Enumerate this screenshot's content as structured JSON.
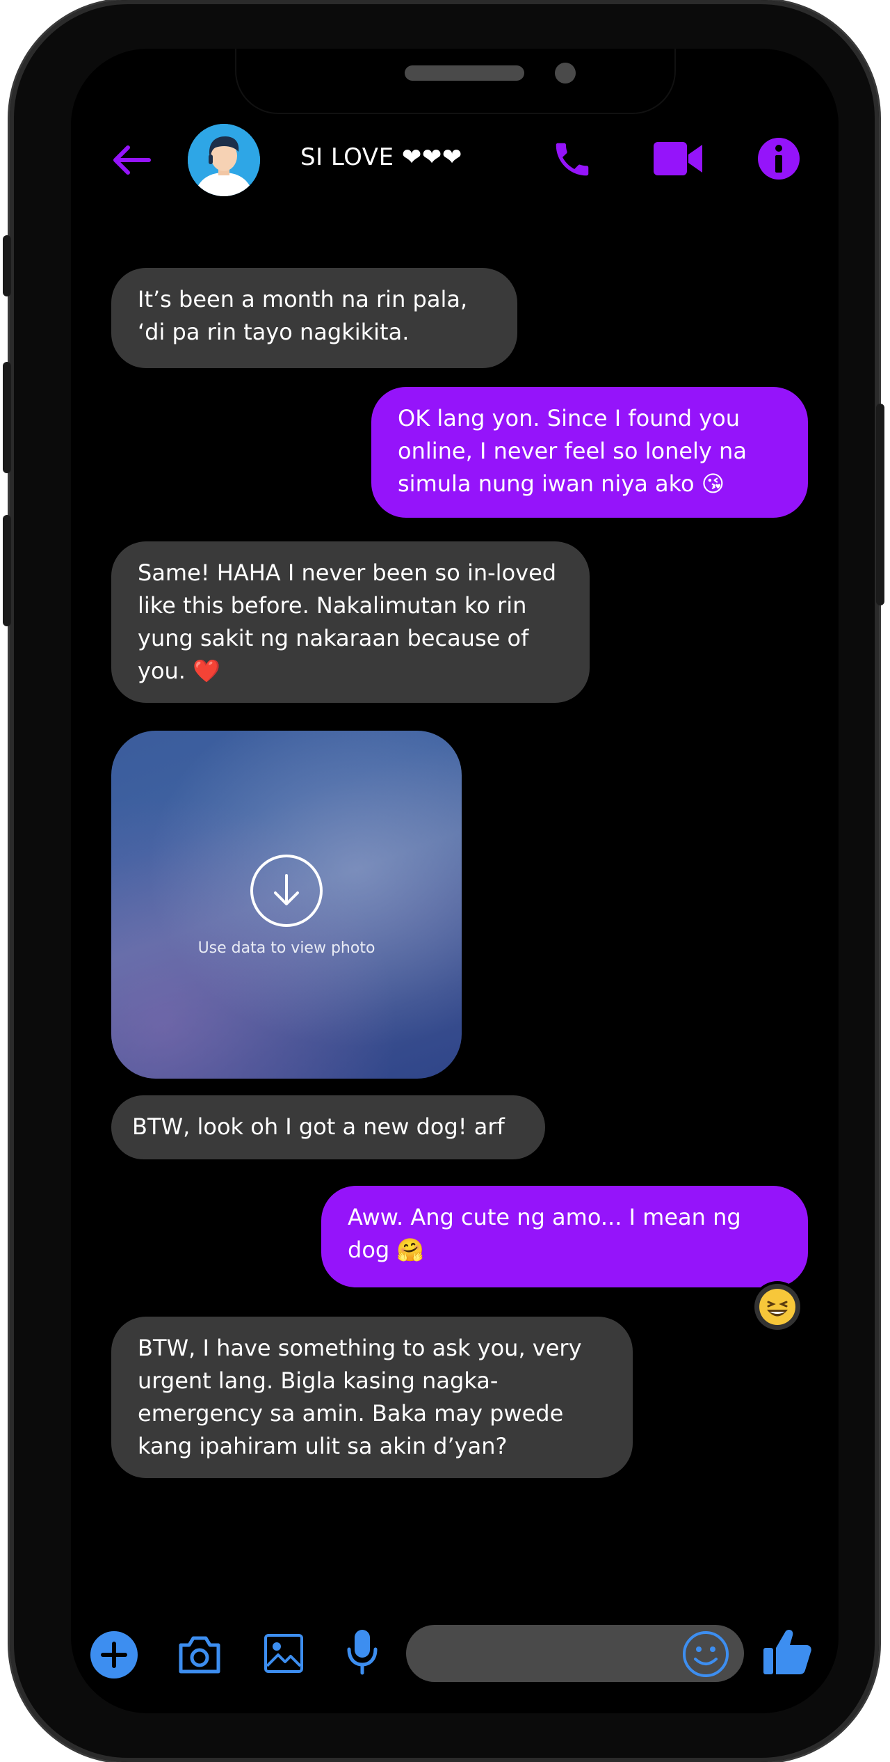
{
  "header": {
    "contact_name": "SI LOVE ❤❤❤"
  },
  "messages": [
    {
      "side": "in",
      "text": "It’s been a month na rin pala, ‘di pa rin tayo nagkikita."
    },
    {
      "side": "out",
      "text": "OK lang yon. Since I found you online, I never feel so lonely na simula nung iwan niya ako 😘"
    },
    {
      "side": "in",
      "text": "Same! HAHA I never been so in-loved like this before. Nakalimutan ko rin yung sakit ng nakaraan because of you. ❤️"
    },
    {
      "side": "in",
      "text": "BTW, look oh I got a new dog! arf"
    },
    {
      "side": "out",
      "text": "Aww. Ang cute ng amo... I mean ng dog 🤗"
    },
    {
      "side": "in",
      "text": "BTW, I have something to ask you, very urgent lang. Bigla kasing nagka-emergency sa amin. Baka may pwede kang ipahiram ulit sa akin d’yan?"
    }
  ],
  "photo": {
    "caption": "Use data to view photo"
  },
  "reaction": "😆",
  "icons": {
    "back": "back-arrow-icon",
    "call": "phone-icon",
    "video": "video-camera-icon",
    "info": "info-icon",
    "plus": "plus-icon",
    "camera": "camera-icon",
    "gallery": "image-icon",
    "mic": "microphone-icon",
    "emoji": "emoji-icon",
    "like": "thumbs-up-icon"
  },
  "colors": {
    "accent": "#9514fa",
    "incoming_bubble": "#3a3a3a",
    "bottom_icons": "#3d8ef0"
  }
}
